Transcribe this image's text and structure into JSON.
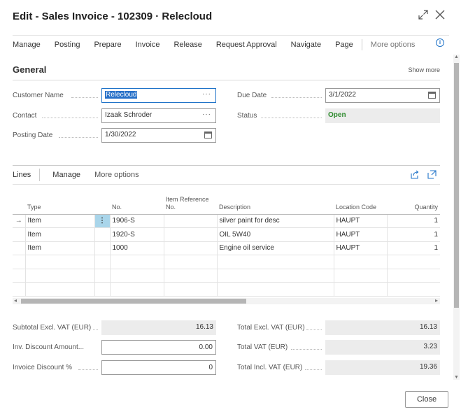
{
  "window": {
    "title": "Edit - Sales Invoice - 102309 · Relecloud",
    "expand_icon": "expand-icon",
    "close_icon": "close-icon"
  },
  "menu": {
    "items": [
      "Manage",
      "Posting",
      "Prepare",
      "Invoice",
      "Release",
      "Request Approval",
      "Navigate",
      "Page"
    ],
    "more": "More options",
    "info_icon": "info-icon"
  },
  "general": {
    "title": "General",
    "show_more": "Show more",
    "customer_name_label": "Customer Name",
    "customer_name_value": "Relecloud",
    "contact_label": "Contact",
    "contact_value": "Izaak Schroder",
    "posting_date_label": "Posting Date",
    "posting_date_value": "1/30/2022",
    "due_date_label": "Due Date",
    "due_date_value": "3/1/2022",
    "status_label": "Status",
    "status_value": "Open"
  },
  "lines": {
    "title": "Lines",
    "manage": "Manage",
    "more": "More options",
    "share_icon": "share-icon",
    "expand_icon": "expand-icon",
    "columns": [
      "Type",
      "No.",
      "Item Reference No.",
      "Description",
      "Location Code",
      "Quantity"
    ],
    "rows": [
      {
        "type": "Item",
        "no": "1906-S",
        "ref": "",
        "description": "silver paint for desc",
        "location": "HAUPT",
        "quantity": "1"
      },
      {
        "type": "Item",
        "no": "1920-S",
        "ref": "",
        "description": "OIL 5W40",
        "location": "HAUPT",
        "quantity": "1"
      },
      {
        "type": "Item",
        "no": "1000",
        "ref": "",
        "description": "Engine oil service",
        "location": "HAUPT",
        "quantity": "1"
      }
    ]
  },
  "totals": {
    "subtotal_label": "Subtotal Excl. VAT (EUR)",
    "subtotal_value": "16.13",
    "inv_discount_amount_label": "Inv. Discount Amount...",
    "inv_discount_amount_value": "0.00",
    "invoice_discount_pct_label": "Invoice Discount %",
    "invoice_discount_pct_value": "0",
    "total_excl_label": "Total Excl. VAT (EUR)",
    "total_excl_value": "16.13",
    "total_vat_label": "Total VAT (EUR)",
    "total_vat_value": "3.23",
    "total_incl_label": "Total Incl. VAT (EUR)",
    "total_incl_value": "19.36"
  },
  "footer": {
    "close_label": "Close"
  }
}
